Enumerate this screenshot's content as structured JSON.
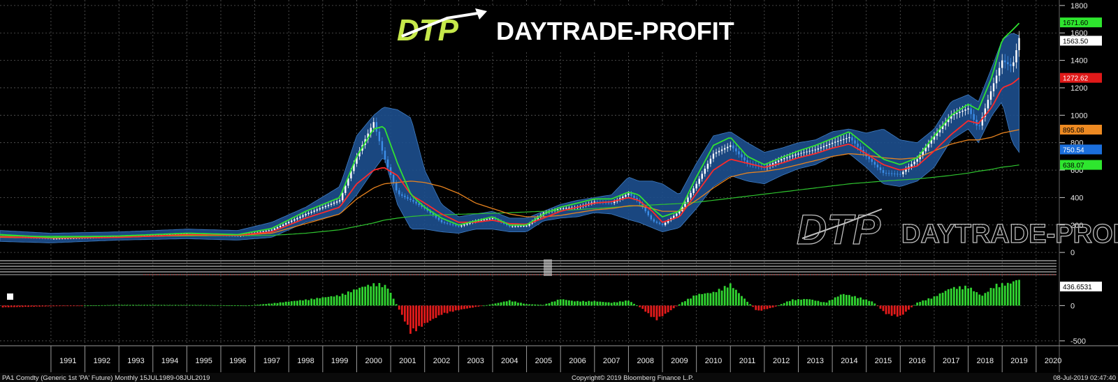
{
  "logo": {
    "mark": "DTP",
    "name": "DAYTRADE-PROFIT"
  },
  "watermark": {
    "mark": "DTP",
    "name": "DAYTRADE-PROFIT"
  },
  "footer": {
    "left": "PA1 Comdty (Generic 1st 'PA' Future)  Monthly 15JUL1989-08JUL2019",
    "center": "Copyright© 2019 Bloomberg Finance L.P.",
    "right": "08-Jul-2019 02:47:40"
  },
  "colors": {
    "background": "#000000",
    "band_fill": "#1d4f8e",
    "ma_fast": "#31e331",
    "ma_mid": "#ff2a2a",
    "ma_slow": "#e8831e",
    "ma_long": "#2fc42f",
    "candle_up": "#ffffff",
    "candle_down": "#3d8ee8",
    "hist_pos": "#31d431",
    "hist_neg": "#e31b1b"
  },
  "chart_data": [
    {
      "type": "line",
      "subtype": "candlestick-with-overlays",
      "title": "",
      "xlabel": "",
      "ylabel": "",
      "x_labels": [
        "1991",
        "1992",
        "1993",
        "1994",
        "1995",
        "1996",
        "1997",
        "1998",
        "1999",
        "2000",
        "2001",
        "2002",
        "2003",
        "2004",
        "2005",
        "2006",
        "2007",
        "2008",
        "2009",
        "2010",
        "2011",
        "2012",
        "2013",
        "2014",
        "2015",
        "2016",
        "2017",
        "2018",
        "2019",
        "2020"
      ],
      "y_ticks": [
        0,
        200,
        400,
        600,
        800,
        1000,
        1200,
        1400,
        1600,
        1800
      ],
      "ylim": [
        -40,
        1840
      ],
      "grid": true,
      "badges": [
        {
          "label": "1671.60",
          "value": 1671.6,
          "color": "#2ee62e",
          "text_color": "#000000"
        },
        {
          "label": "1563.50",
          "value": 1563.5,
          "color": "#ffffff",
          "text_color": "#000000"
        },
        {
          "label": "1272.62",
          "value": 1272.62,
          "color": "#e01919",
          "text_color": "#ffffff"
        },
        {
          "label": "895.08",
          "value": 895.08,
          "color": "#ee8a22",
          "text_color": "#000000"
        },
        {
          "label": "750.54",
          "value": 750.54,
          "color": "#1b6fdc",
          "text_color": "#ffffff"
        },
        {
          "label": "638.07",
          "value": 638.07,
          "color": "#2ee62e",
          "text_color": "#000000"
        }
      ],
      "anchors_x": [
        1989.5,
        1991,
        1993,
        1995,
        1996.5,
        1997.5,
        1998.5,
        1999.5,
        2000.0,
        2000.5,
        2000.8,
        2001.2,
        2001.6,
        2002.0,
        2002.5,
        2003.0,
        2003.5,
        2004.0,
        2004.5,
        2005.0,
        2005.5,
        2006.0,
        2006.5,
        2007.0,
        2007.5,
        2008.0,
        2008.3,
        2008.7,
        2009.0,
        2009.5,
        2010.0,
        2010.5,
        2011.0,
        2011.5,
        2012.0,
        2012.5,
        2013.0,
        2013.5,
        2014.0,
        2014.5,
        2015.0,
        2015.5,
        2016.0,
        2016.5,
        2017.0,
        2017.5,
        2018.0,
        2018.3,
        2018.7,
        2019.0,
        2019.3,
        2019.5
      ],
      "series": [
        {
          "key": "close",
          "values": [
            120,
            100,
            115,
            135,
            120,
            165,
            280,
            380,
            700,
            950,
            700,
            430,
            380,
            320,
            220,
            190,
            230,
            250,
            190,
            195,
            290,
            320,
            330,
            370,
            360,
            430,
            370,
            230,
            200,
            300,
            500,
            720,
            780,
            650,
            620,
            680,
            720,
            750,
            800,
            840,
            700,
            580,
            570,
            680,
            850,
            1000,
            1050,
            900,
            1200,
            1400,
            1350,
            1563
          ]
        },
        {
          "key": "band_upper",
          "values": [
            160,
            140,
            150,
            170,
            160,
            220,
            330,
            480,
            850,
            1000,
            1060,
            1040,
            980,
            600,
            350,
            260,
            280,
            300,
            250,
            250,
            300,
            350,
            380,
            400,
            420,
            550,
            520,
            520,
            500,
            420,
            650,
            850,
            880,
            800,
            730,
            760,
            800,
            820,
            880,
            900,
            870,
            900,
            820,
            800,
            900,
            1100,
            1150,
            1100,
            1350,
            1550,
            1600,
            1580
          ]
        },
        {
          "key": "band_lower",
          "values": [
            80,
            70,
            90,
            100,
            90,
            110,
            220,
            280,
            420,
            600,
            700,
            350,
            170,
            170,
            150,
            140,
            170,
            170,
            150,
            150,
            230,
            250,
            260,
            290,
            280,
            240,
            220,
            180,
            150,
            180,
            320,
            480,
            560,
            520,
            500,
            560,
            610,
            640,
            700,
            720,
            620,
            500,
            480,
            520,
            620,
            820,
            900,
            800,
            1000,
            1100,
            800,
            730
          ]
        },
        {
          "key": "ma_fast",
          "values": [
            130,
            110,
            120,
            140,
            130,
            175,
            300,
            400,
            700,
            900,
            920,
            650,
            420,
            330,
            250,
            200,
            230,
            260,
            200,
            200,
            280,
            330,
            360,
            390,
            390,
            440,
            420,
            320,
            260,
            300,
            550,
            780,
            840,
            700,
            640,
            690,
            740,
            780,
            830,
            880,
            780,
            680,
            640,
            690,
            850,
            1000,
            1080,
            1040,
            1280,
            1550,
            1620,
            1671
          ]
        },
        {
          "key": "ma_mid",
          "values": [
            115,
            105,
            110,
            130,
            125,
            150,
            250,
            330,
            500,
            600,
            620,
            560,
            420,
            360,
            280,
            220,
            220,
            235,
            210,
            205,
            250,
            300,
            330,
            360,
            370,
            400,
            380,
            300,
            220,
            260,
            430,
            600,
            680,
            650,
            620,
            650,
            690,
            720,
            760,
            790,
            720,
            640,
            600,
            630,
            740,
            860,
            960,
            940,
            1060,
            1200,
            1230,
            1272
          ]
        },
        {
          "key": "ma_slow",
          "values": [
            110,
            105,
            110,
            125,
            125,
            140,
            210,
            280,
            390,
            470,
            500,
            510,
            520,
            510,
            480,
            430,
            360,
            320,
            280,
            260,
            260,
            270,
            290,
            310,
            320,
            340,
            340,
            320,
            300,
            300,
            380,
            470,
            550,
            580,
            590,
            610,
            640,
            670,
            700,
            720,
            710,
            690,
            680,
            690,
            740,
            790,
            820,
            820,
            840,
            870,
            885,
            895
          ]
        },
        {
          "key": "ma_long",
          "values": [
            120,
            118,
            118,
            120,
            122,
            124,
            140,
            165,
            190,
            215,
            235,
            250,
            262,
            270,
            274,
            278,
            282,
            285,
            290,
            295,
            300,
            306,
            312,
            320,
            328,
            336,
            342,
            346,
            350,
            356,
            366,
            380,
            395,
            410,
            425,
            440,
            455,
            470,
            485,
            500,
            510,
            520,
            528,
            536,
            548,
            562,
            578,
            592,
            606,
            622,
            630,
            638
          ]
        }
      ]
    },
    {
      "type": "bar",
      "subtype": "histogram",
      "y_ticks": [
        -500,
        0
      ],
      "ylim": [
        -560,
        330
      ],
      "badges": [
        {
          "label": "436.6531",
          "value": 436.6531,
          "color": "#ffffff",
          "text_color": "#000000"
        }
      ],
      "anchors_x": [
        1989.5,
        1993.0,
        1995.5,
        1996.8,
        1997.5,
        1998.5,
        1999.5,
        2000.2,
        2000.6,
        2000.9,
        2001.3,
        2001.6,
        2002.0,
        2002.5,
        2003.0,
        2003.5,
        2004.0,
        2004.5,
        2005.0,
        2005.5,
        2006.0,
        2006.4,
        2007.0,
        2007.5,
        2008.0,
        2008.4,
        2008.8,
        2009.2,
        2009.6,
        2010.0,
        2010.5,
        2011.0,
        2011.4,
        2011.8,
        2012.3,
        2012.8,
        2013.3,
        2013.8,
        2014.3,
        2014.8,
        2015.2,
        2015.6,
        2016.0,
        2016.5,
        2017.0,
        2017.5,
        2018.0,
        2018.4,
        2018.8,
        2019.2,
        2019.5
      ],
      "series": [
        {
          "key": "histogram",
          "values": [
            -25,
            10,
            8,
            0,
            30,
            80,
            140,
            260,
            300,
            260,
            -100,
            -380,
            -250,
            -120,
            -60,
            -20,
            20,
            70,
            20,
            10,
            90,
            60,
            60,
            40,
            70,
            -40,
            -200,
            -80,
            50,
            150,
            180,
            290,
            100,
            -80,
            -20,
            80,
            90,
            40,
            160,
            110,
            50,
            -120,
            -150,
            40,
            120,
            240,
            260,
            130,
            280,
            300,
            360
          ]
        }
      ]
    }
  ]
}
